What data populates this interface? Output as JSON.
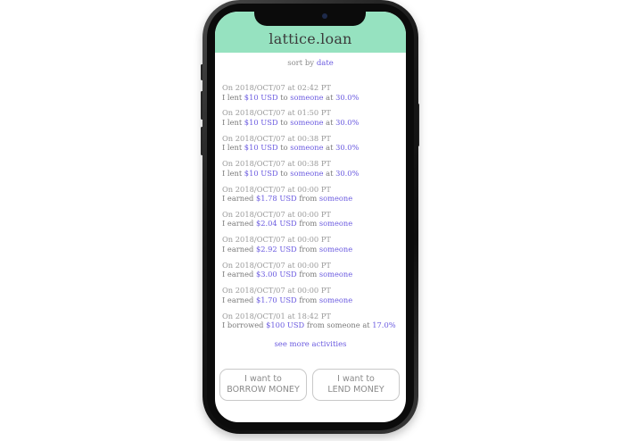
{
  "app": {
    "title": "lattice.loan"
  },
  "sort": {
    "prefix": "sort by",
    "value": "date"
  },
  "activities": [
    {
      "date": "On 2018/OCT/07 at 02:42 PT",
      "verb": "I lent",
      "amount": "$10 USD",
      "prep": "to",
      "party": "someone",
      "at": "at",
      "rate": "30.0%"
    },
    {
      "date": "On 2018/OCT/07 at 01:50 PT",
      "verb": "I lent",
      "amount": "$10 USD",
      "prep": "to",
      "party": "someone",
      "at": "at",
      "rate": "30.0%"
    },
    {
      "date": "On 2018/OCT/07 at 00:38 PT",
      "verb": "I lent",
      "amount": "$10 USD",
      "prep": "to",
      "party": "someone",
      "at": "at",
      "rate": "30.0%"
    },
    {
      "date": "On 2018/OCT/07 at 00:38 PT",
      "verb": "I lent",
      "amount": "$10 USD",
      "prep": "to",
      "party": "someone",
      "at": "at",
      "rate": "30.0%"
    },
    {
      "date": "On 2018/OCT/07 at 00:00 PT",
      "verb": "I earned",
      "amount": "$1.78 USD",
      "prep": "from",
      "party": "someone",
      "at": "",
      "rate": ""
    },
    {
      "date": "On 2018/OCT/07 at 00:00 PT",
      "verb": "I earned",
      "amount": "$2.04 USD",
      "prep": "from",
      "party": "someone",
      "at": "",
      "rate": ""
    },
    {
      "date": "On 2018/OCT/07 at 00:00 PT",
      "verb": "I earned",
      "amount": "$2.92 USD",
      "prep": "from",
      "party": "someone",
      "at": "",
      "rate": ""
    },
    {
      "date": "On 2018/OCT/07 at 00:00 PT",
      "verb": "I earned",
      "amount": "$3.00 USD",
      "prep": "from",
      "party": "someone",
      "at": "",
      "rate": ""
    },
    {
      "date": "On 2018/OCT/07 at 00:00 PT",
      "verb": "I earned",
      "amount": "$1.70 USD",
      "prep": "from",
      "party": "someone",
      "at": "",
      "rate": ""
    },
    {
      "date": "On 2018/OCT/01 at 18:42 PT",
      "verb": "I borrowed",
      "amount": "$100 USD",
      "prep": "from someone",
      "party": "",
      "at": "at",
      "rate": "17.0%"
    }
  ],
  "see_more": "see more activities",
  "actions": {
    "borrow": {
      "line1": "I want to",
      "line2": "BORROW MONEY"
    },
    "lend": {
      "line1": "I want to",
      "line2": "LEND MONEY"
    }
  },
  "colors": {
    "header": "#96e2c0",
    "accent": "#6b5be0"
  }
}
